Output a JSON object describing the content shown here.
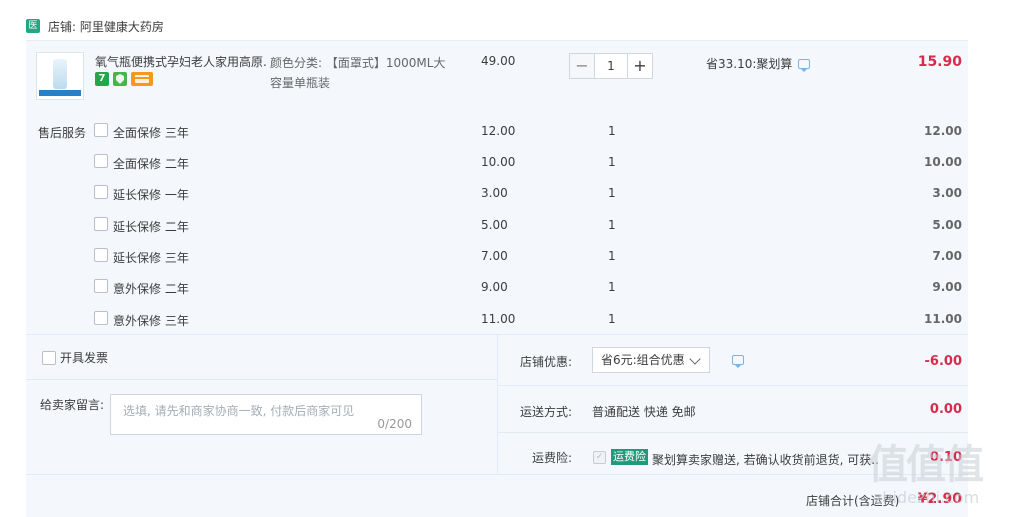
{
  "store": {
    "icon_text": "医",
    "name": "店铺: 阿里健康大药房"
  },
  "product": {
    "title": "氧气瓶便携式孕妇老人家用高原...",
    "badges": [
      "7",
      "",
      ""
    ],
    "sku": "颜色分类: 【面罩式】1000ML大容量单瓶装",
    "price": "49.00",
    "qty_minus": "−",
    "quantity": "1",
    "qty_plus": "+",
    "promo": "省33.10:聚划算",
    "total": "15.90"
  },
  "services": {
    "label": "售后服务",
    "items": [
      {
        "name": "全面保修 三年",
        "price": "12.00",
        "qty": "1",
        "total": "12.00"
      },
      {
        "name": "全面保修 二年",
        "price": "10.00",
        "qty": "1",
        "total": "10.00"
      },
      {
        "name": "延长保修 一年",
        "price": "3.00",
        "qty": "1",
        "total": "3.00"
      },
      {
        "name": "延长保修 二年",
        "price": "5.00",
        "qty": "1",
        "total": "5.00"
      },
      {
        "name": "延长保修 三年",
        "price": "7.00",
        "qty": "1",
        "total": "7.00"
      },
      {
        "name": "意外保修 二年",
        "price": "9.00",
        "qty": "1",
        "total": "9.00"
      },
      {
        "name": "意外保修 三年",
        "price": "11.00",
        "qty": "1",
        "total": "11.00"
      }
    ]
  },
  "invoice": {
    "label": "开具发票"
  },
  "message": {
    "label": "给卖家留言:",
    "placeholder": "选填, 请先和商家协商一致, 付款后商家可见",
    "count": "0/200"
  },
  "discount": {
    "label": "店铺优惠:",
    "selected": "省6元:组合优惠",
    "value": "-6.00"
  },
  "shipping": {
    "label": "运送方式:",
    "method": "普通配送 快递 免邮",
    "value": "0.00"
  },
  "insurance": {
    "label": "运费险:",
    "tag": "运费险",
    "text": "聚划算卖家赠送, 若确认收货前退货, 可获...",
    "value": "0.10"
  },
  "footer": {
    "label": "店铺合计(含运费)",
    "value": "¥2.90"
  },
  "watermark": {
    "big": "值值值",
    "small": "zhidezhi.com"
  },
  "colors": {
    "accent_red": "#d62c4b",
    "store_green": "#1fa882",
    "panel_bg": "#f4f8fd"
  }
}
